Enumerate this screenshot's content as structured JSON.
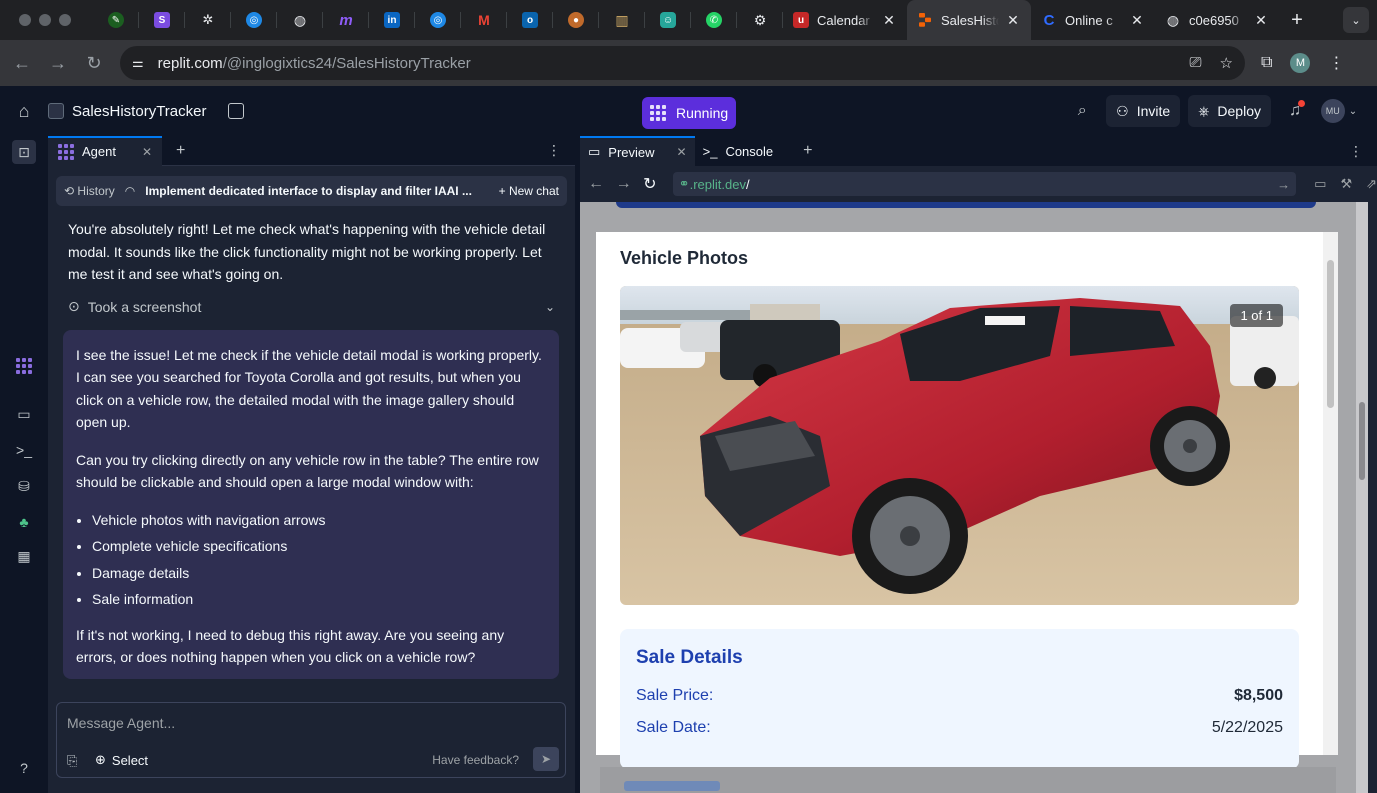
{
  "browser": {
    "tabs": [
      {
        "title": "Calendar",
        "color": "#c62828",
        "letter": "u"
      },
      {
        "title": "SalesHistoryTracker",
        "color": "#f26207",
        "letter": "",
        "active": true
      },
      {
        "title": "Online c",
        "color": "#1a73e8",
        "letter": "C"
      },
      {
        "title": "c0e6950",
        "color": "#5f6368",
        "letter": ""
      }
    ],
    "url_host": "replit.com",
    "url_path": "/@inglogixtics24/SalesHistoryTracker",
    "profile_initial": "M"
  },
  "header": {
    "project_name": "SalesHistoryTracker",
    "run_label": "Running",
    "invite_label": "Invite",
    "deploy_label": "Deploy",
    "user_initials": "MU"
  },
  "agent": {
    "tab_label": "Agent",
    "history_label": "History",
    "chat_title": "Implement dedicated interface to display and filter IAAI ...",
    "new_chat_label": "New chat",
    "message_1": "You're absolutely right! Let me check what's happening with the vehicle detail modal. It sounds like the click functionality might not be working properly. Let me test it and see what's going on.",
    "screenshot_label": "Took a screenshot",
    "bubble_p1": "I see the issue! Let me check if the vehicle detail modal is working properly. I can see you searched for Toyota Corolla and got results, but when you click on a vehicle row, the detailed modal with the image gallery should open up.",
    "bubble_p2": "Can you try clicking directly on any vehicle row in the table? The entire row should be clickable and should open a large modal window with:",
    "bubble_list": [
      "Vehicle photos with navigation arrows",
      "Complete vehicle specifications",
      "Damage details",
      "Sale information"
    ],
    "bubble_p3": "If it's not working, I need to debug this right away. Are you seeing any errors, or does nothing happen when you click on a vehicle row?",
    "composer_placeholder": "Message Agent...",
    "select_label": "Select",
    "feedback_label": "Have feedback?"
  },
  "preview": {
    "tab_preview": "Preview",
    "tab_console": "Console",
    "url_domain": ".replit.dev",
    "url_path": "/",
    "modal_title": "Vehicle Photos",
    "photo_counter": "1 of 1",
    "sale_title": "Sale Details",
    "sale_price_label": "Sale Price:",
    "sale_price_value": "$8,500",
    "sale_date_label": "Sale Date:",
    "sale_date_value": "5/22/2025"
  }
}
